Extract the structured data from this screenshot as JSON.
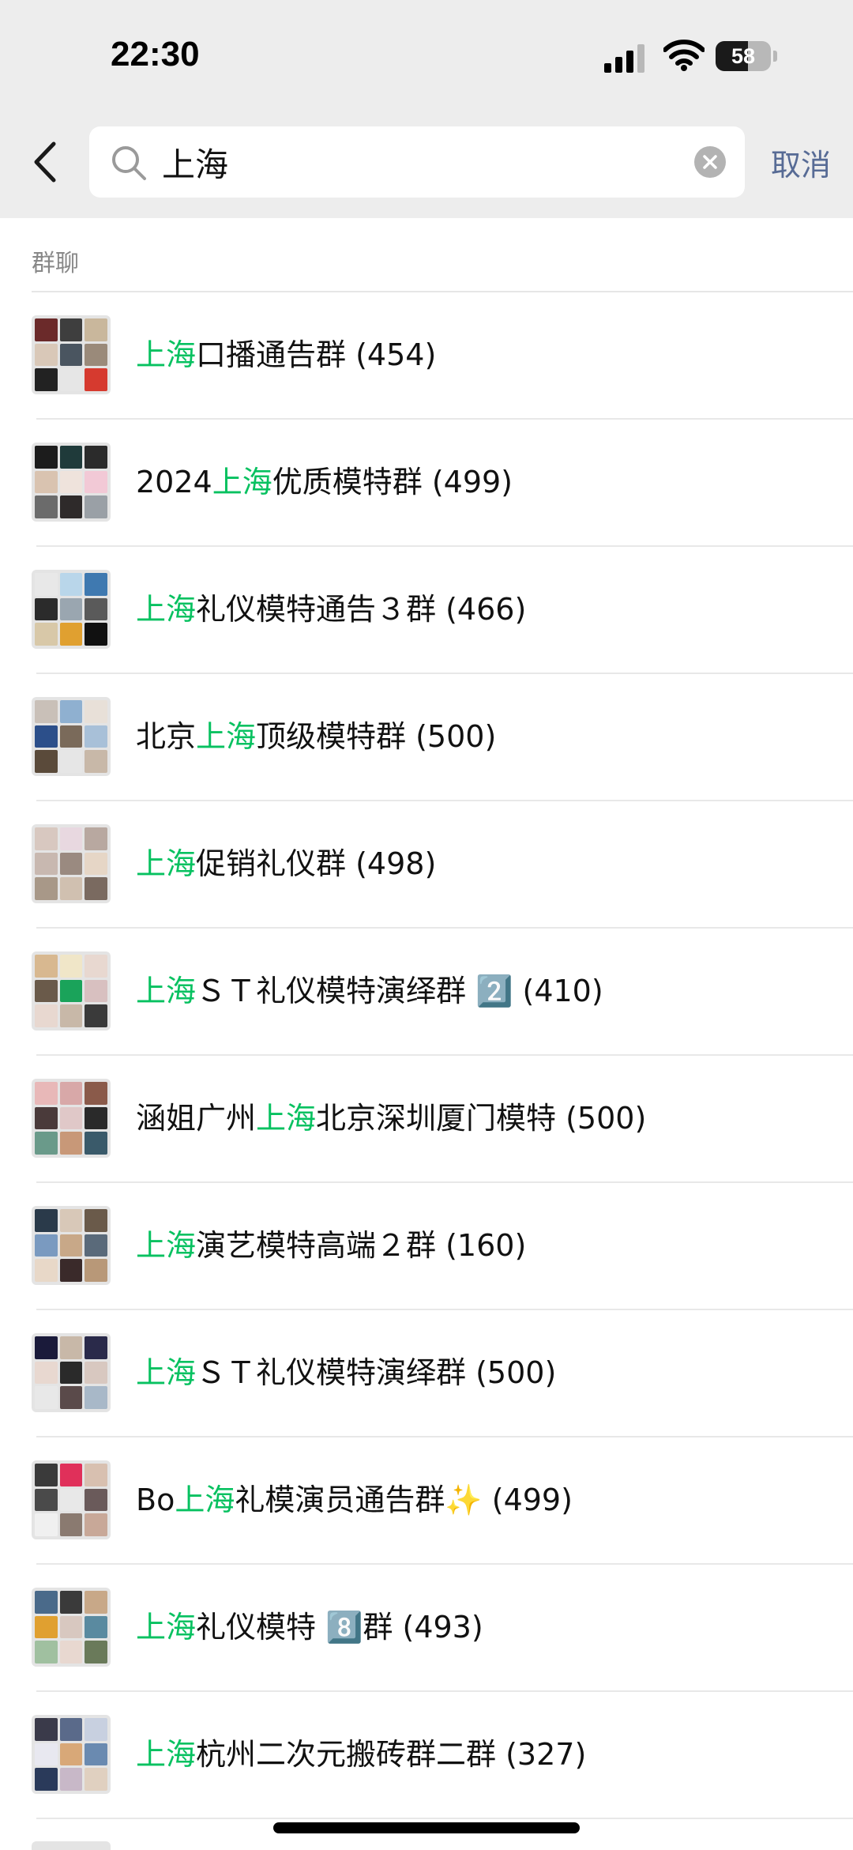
{
  "status_bar": {
    "time": "22:30",
    "battery": "58",
    "battery_level": 0.58
  },
  "search": {
    "value": "上海",
    "placeholder": "",
    "cancel_label": "取消"
  },
  "section": {
    "label": "群聊"
  },
  "colors": {
    "highlight": "#07c160",
    "cancel": "#576b95",
    "header_bg": "#ededed"
  },
  "results": [
    {
      "pre": "",
      "hl": "上海",
      "post": "口播通告群 (454)",
      "thumbs": [
        "#6b2a2a",
        "#3e3e3e",
        "#c9b79c",
        "#d9c8b8",
        "#4a5560",
        "#9a8a7a",
        "#222222",
        "#e6e6e6",
        "#d63a2f"
      ]
    },
    {
      "pre": "2024",
      "hl": "上海",
      "post": "优质模特群 (499)",
      "thumbs": [
        "#1c1c1c",
        "#1f3a3a",
        "#2b2b2b",
        "#d9c3b0",
        "#efe3dc",
        "#f2c9d6",
        "#6b6b6b",
        "#2e2a2a",
        "#9aa0a6"
      ]
    },
    {
      "pre": "",
      "hl": "上海",
      "post": "礼仪模特通告３群 (466)",
      "thumbs": [
        "#e8e8e8",
        "#b9d6ea",
        "#3f79b0",
        "#2b2b2b",
        "#9aa6b0",
        "#5a5a5a",
        "#d8c8a8",
        "#e0a030",
        "#111111"
      ]
    },
    {
      "pre": "北京",
      "hl": "上海",
      "post": "顶级模特群 (500)",
      "thumbs": [
        "#c9c0b8",
        "#8fb0d0",
        "#e8e0d8",
        "#2c4f8a",
        "#7a6a5a",
        "#a8c0d8",
        "#5a4a3a",
        "#e6e6e6",
        "#c8b8a8"
      ]
    },
    {
      "pre": "",
      "hl": "上海",
      "post": "促销礼仪群 (498)",
      "thumbs": [
        "#d8c8c0",
        "#e8d8e0",
        "#b8a8a0",
        "#c8b8b0",
        "#9a8a80",
        "#e6d6c6",
        "#a89888",
        "#d0c0b0",
        "#7a6a60"
      ]
    },
    {
      "pre": "",
      "hl": "上海",
      "post": "ＳＴ礼仪模特演绎群 2️⃣ (410)",
      "thumbs": [
        "#d8b890",
        "#f0e6c8",
        "#e8d8d0",
        "#6a5a4a",
        "#1aa35a",
        "#d8c0c0",
        "#e8d8d0",
        "#c8b8a8",
        "#3a3a3a"
      ]
    },
    {
      "pre": "涵姐广州",
      "hl": "上海",
      "post": "北京深圳厦门模特 (500)",
      "thumbs": [
        "#e8b8b8",
        "#d8a8a8",
        "#8a5a4a",
        "#4a3a3a",
        "#e0c8c8",
        "#2a2a2a",
        "#6a9a8a",
        "#c89878",
        "#3a5a6a"
      ]
    },
    {
      "pre": "",
      "hl": "上海",
      "post": "演艺模特高端２群 (160)",
      "thumbs": [
        "#2a3a4a",
        "#d8c8b8",
        "#6a5a4a",
        "#7a9ac0",
        "#c8a888",
        "#5a6a7a",
        "#e8d8c8",
        "#3a2a2a",
        "#b89878"
      ]
    },
    {
      "pre": "",
      "hl": "上海",
      "post": "ＳＴ礼仪模特演绎群 (500)",
      "thumbs": [
        "#1a1a3a",
        "#c8b8a8",
        "#2a2a4a",
        "#e8d8d0",
        "#2a2a2a",
        "#d8c8c0",
        "#e8e8e8",
        "#5a4a4a",
        "#a8b8c8"
      ]
    },
    {
      "pre": "Bo",
      "hl": "上海",
      "post": "礼模演员通告群✨ (499)",
      "thumbs": [
        "#3a3a3a",
        "#e0305a",
        "#d8c0b0",
        "#4a4a4a",
        "#e8e8e8",
        "#6a5a5a",
        "#f0f0f0",
        "#8a7a70",
        "#c8a898"
      ]
    },
    {
      "pre": "",
      "hl": "上海",
      "post": "礼仪模特 8️⃣群 (493)",
      "thumbs": [
        "#4a6a8a",
        "#3a3a3a",
        "#c8a888",
        "#e0a030",
        "#d8c8c0",
        "#5a8aa0",
        "#a0c0a0",
        "#e8d8d0",
        "#6a7a5a"
      ]
    },
    {
      "pre": "",
      "hl": "上海",
      "post": "杭州二次元搬砖群二群 (327)",
      "thumbs": [
        "#3a3a4a",
        "#5a6a8a",
        "#c8d0e0",
        "#e8e8f0",
        "#d8a878",
        "#6a8ab0",
        "#2a3a5a",
        "#c8b8c8",
        "#e0d0c0"
      ]
    }
  ]
}
